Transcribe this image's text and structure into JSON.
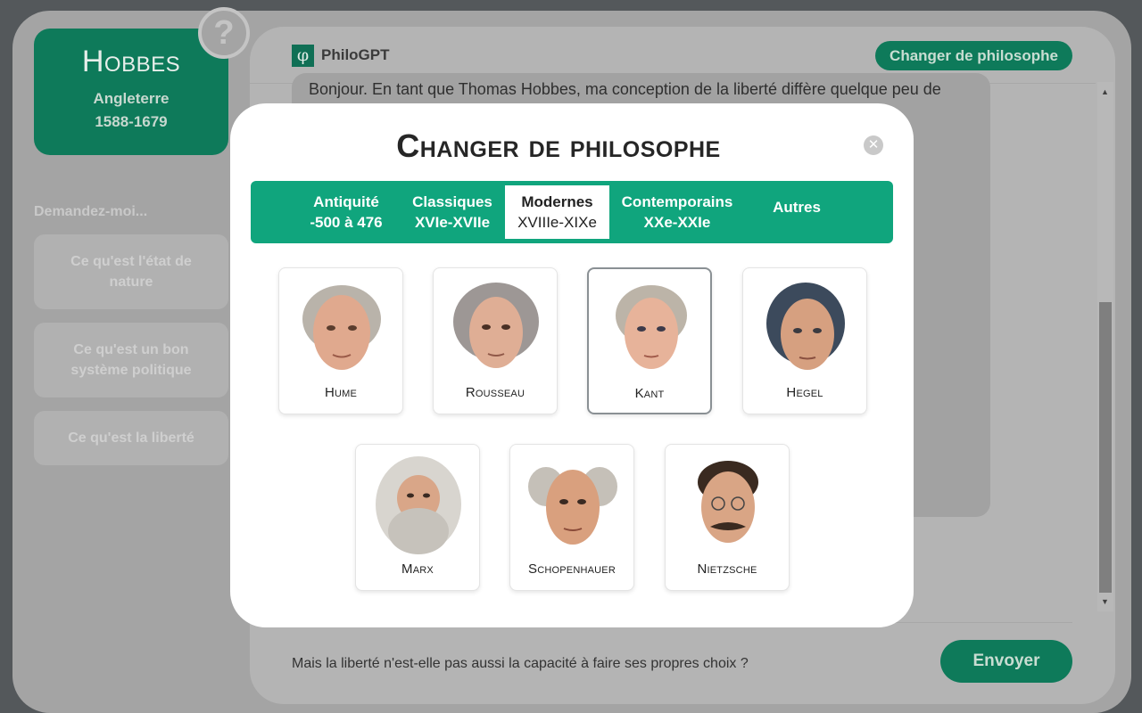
{
  "sidebar": {
    "philosopher": {
      "name": "Hobbes",
      "country": "Angleterre",
      "dates": "1588-1679"
    },
    "help_icon": "?",
    "ask_label": "Demandez-moi...",
    "suggestions": [
      "Ce qu'est l'état de nature",
      "Ce qu'est un bon système politique",
      "Ce qu'est la liberté"
    ]
  },
  "chat": {
    "app_title": "PhiloGPT",
    "logo_glyph": "φ",
    "change_button": "Changer de philosophe",
    "bubble_text": "Bonjour. En tant que Thomas Hobbes, ma conception de la liberté diffère quelque peu de",
    "message_value": "Mais la liberté n'est-elle pas aussi la capacité à faire ses propres choix ?",
    "send_button": "Envoyer"
  },
  "modal": {
    "title": "Changer de philosophe",
    "tabs": [
      {
        "label": "Antiquité",
        "sub": "-500 à 476"
      },
      {
        "label": "Classiques",
        "sub": "XVIe-XVIIe"
      },
      {
        "label": "Modernes",
        "sub": "XVIIIe-XIXe"
      },
      {
        "label": "Contemporains",
        "sub": "XXe-XXIe"
      },
      {
        "label": "Autres",
        "sub": ""
      }
    ],
    "active_tab": "Modernes",
    "philosophers": [
      "Hume",
      "Rousseau",
      "Kant",
      "Hegel",
      "Marx",
      "Schopenhauer",
      "Nietzsche"
    ],
    "selected": "Kant"
  },
  "colors": {
    "accent_green": "#10a57d",
    "dark_green": "#0e7a5a",
    "overlay_gray": "#a4a4a4"
  }
}
